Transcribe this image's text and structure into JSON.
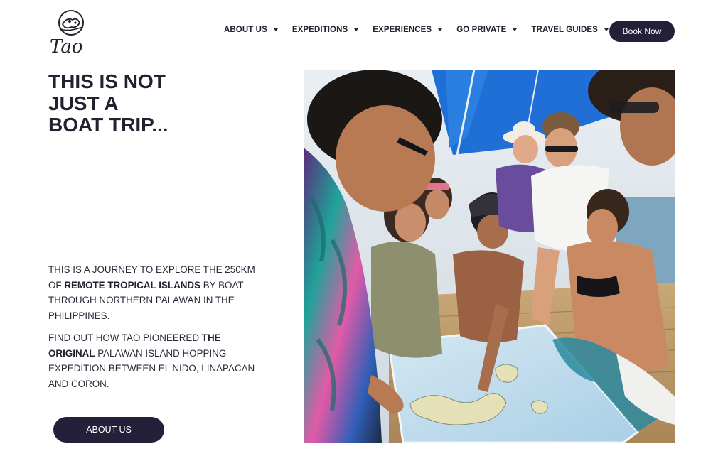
{
  "header": {
    "logo_text": "Tao",
    "nav": [
      {
        "label": "ABOUT US"
      },
      {
        "label": "EXPEDITIONS"
      },
      {
        "label": "EXPERIENCES"
      },
      {
        "label": "GO PRIVATE"
      },
      {
        "label": "TRAVEL GUIDES"
      }
    ],
    "book_button": "Book Now"
  },
  "hero": {
    "title_lines": [
      "THIS IS NOT",
      "JUST A",
      "BOAT TRIP..."
    ],
    "paragraph1": {
      "part1": "THIS IS A JOURNEY TO EXPLORE THE 250KM OF ",
      "bold": "REMOTE TROPICAL ISLANDS",
      "part2": " BY BOAT THROUGH NORTHERN PALAWAN IN THE PHILIPPINES."
    },
    "paragraph2": {
      "part1": "FIND OUT HOW TAO PIONEERED ",
      "bold": "THE ORIGINAL",
      "part2": " PALAWAN ISLAND HOPPING EXPEDITION BETWEEN EL NIDO, LINAPACAN AND CORON."
    },
    "cta_button": "ABOUT US"
  },
  "colors": {
    "primary_dark": "#23213a",
    "text": "#23212f",
    "canopy_blue": "#1f6fd6",
    "map_sea": "#bcd9ec"
  }
}
